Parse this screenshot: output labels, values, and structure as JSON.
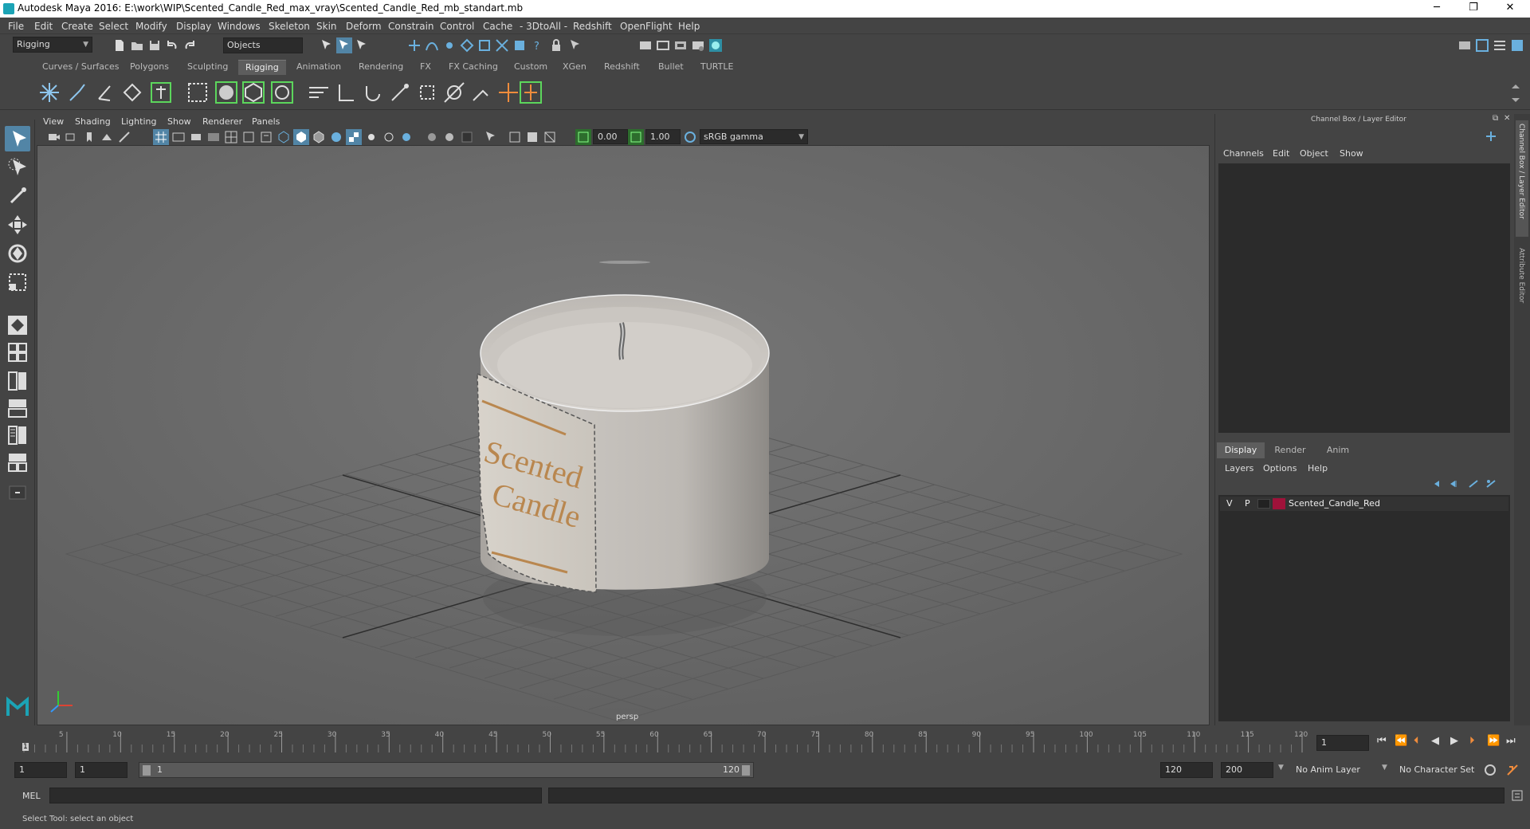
{
  "window": {
    "title": "Autodesk Maya 2016: E:\\work\\WIP\\Scented_Candle_Red_max_vray\\Scented_Candle_Red_mb_standart.mb",
    "minimize": "─",
    "restore": "❐",
    "close": "✕"
  },
  "menubar": [
    "File",
    "Edit",
    "Create",
    "Select",
    "Modify",
    "Display",
    "Windows",
    "Skeleton",
    "Skin",
    "Deform",
    "Constrain",
    "Control",
    "Cache",
    "- 3DtoAll -",
    "Redshift",
    "OpenFlight",
    "Help"
  ],
  "statusline": {
    "menuset": "Rigging",
    "selection_mode": "Objects"
  },
  "shelf_tabs": [
    "Curves / Surfaces",
    "Polygons",
    "Sculpting",
    "Rigging",
    "Animation",
    "Rendering",
    "FX",
    "FX Caching",
    "Custom",
    "XGen",
    "Redshift",
    "Bullet",
    "TURTLE"
  ],
  "active_shelf": "Rigging",
  "viewport": {
    "menus": [
      "View",
      "Shading",
      "Lighting",
      "Show",
      "Renderer",
      "Panels"
    ],
    "exposure": "0.00",
    "gamma": "1.00",
    "color_space": "sRGB gamma",
    "camera_label": "persp",
    "label_line1": "Scented",
    "label_line2": "Candle"
  },
  "channel_box": {
    "title": "Channel Box / Layer Editor",
    "menus": [
      "Channels",
      "Edit",
      "Object",
      "Show"
    ]
  },
  "layer_editor": {
    "tabs": [
      "Display",
      "Render",
      "Anim"
    ],
    "active_tab": "Display",
    "menus": [
      "Layers",
      "Options",
      "Help"
    ],
    "layers": [
      {
        "v": "V",
        "p": "P",
        "name": "Scented_Candle_Red",
        "color": "#a0123a"
      }
    ]
  },
  "side_tabs": [
    "Channel Box / Layer Editor",
    "Attribute Editor"
  ],
  "timeline": {
    "ticks": [
      "5",
      "10",
      "15",
      "20",
      "25",
      "30",
      "35",
      "40",
      "45",
      "50",
      "55",
      "60",
      "65",
      "70",
      "75",
      "80",
      "85",
      "90",
      "95",
      "100",
      "105",
      "110",
      "115",
      "120"
    ],
    "start_marker": "1",
    "current_frame": "1"
  },
  "range": {
    "start": "1",
    "playback_start": "1",
    "slider_start": "1",
    "slider_end": "120",
    "playback_end": "120",
    "end": "200",
    "anim_layer": "No Anim Layer",
    "character_set": "No Character Set"
  },
  "cmdline": {
    "label": "MEL"
  },
  "helpline": {
    "text": "Select Tool: select an object"
  },
  "colors": {
    "accent": "#5285a6",
    "active_tab": "#5d5d5d",
    "viewport_bg": "#6f6f6f",
    "highlight_green": "#5cd65c"
  }
}
